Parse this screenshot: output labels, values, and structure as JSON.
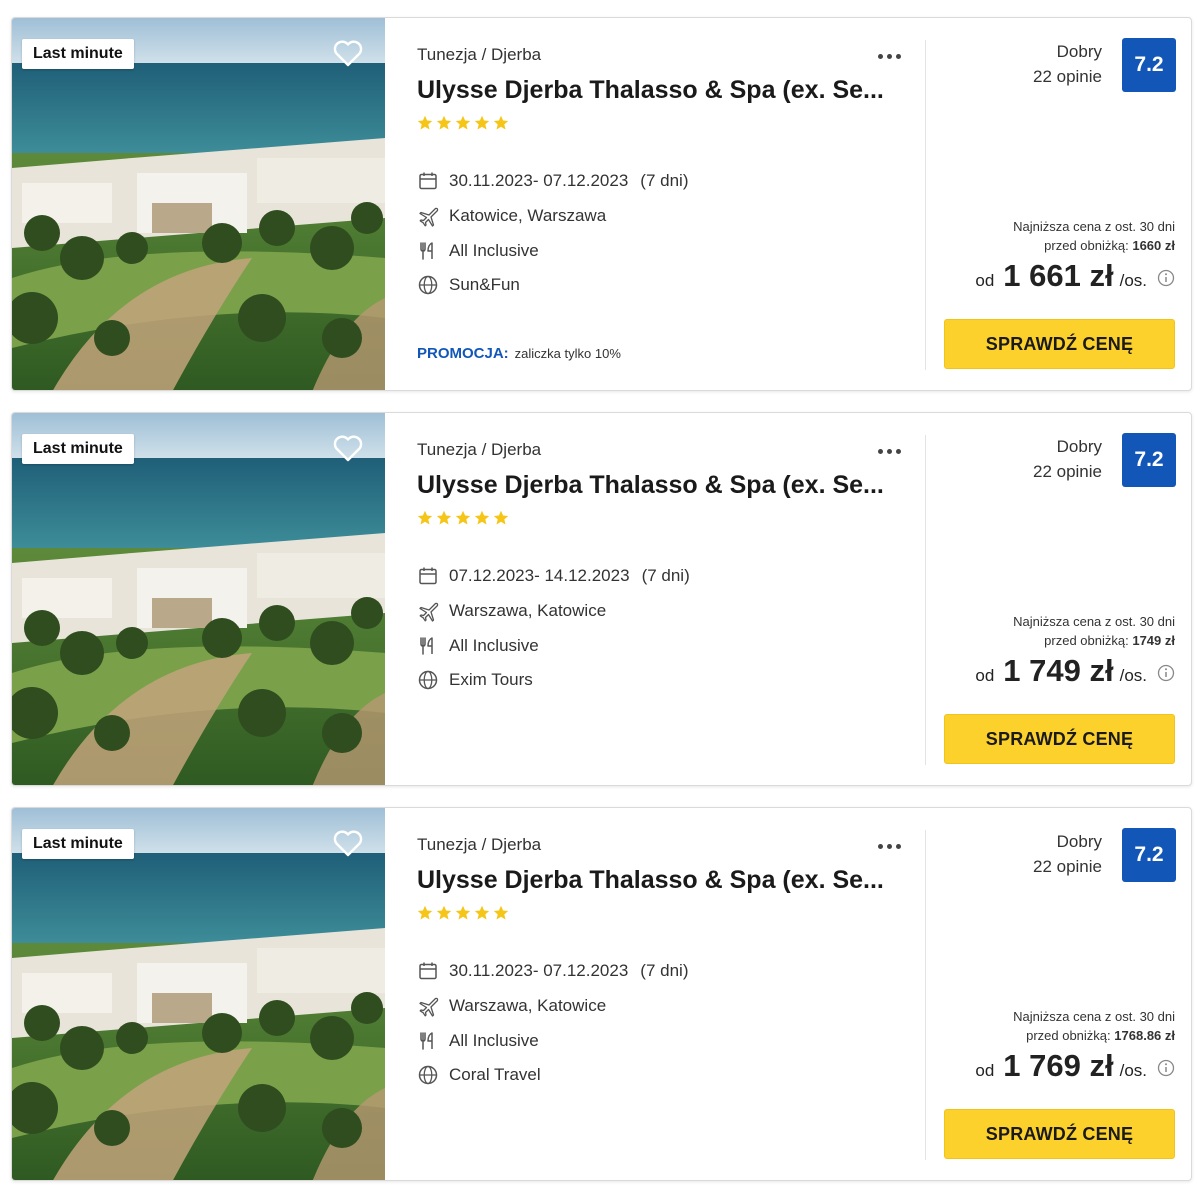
{
  "offers": [
    {
      "badge": "Last minute",
      "location": "Tunezja / Djerba",
      "title": "Ulysse Djerba Thalasso & Spa (ex. Se...",
      "stars": 5,
      "dates": "30.11.2023- 07.12.2023",
      "duration": "(7 dni)",
      "departure": "Katowice, Warszawa",
      "board": "All Inclusive",
      "operator": "Sun&Fun",
      "promo_label": "PROMOCJA:",
      "promo_text": "zaliczka tylko 10%",
      "rating_label": "Dobry",
      "rating_count": "22 opinie",
      "score": "7.2",
      "lowest_line1": "Najniższa cena z ost. 30 dni",
      "lowest_line2_prefix": "przed obniżką:",
      "lowest_value": "1660 zł",
      "price_prefix": "od",
      "price": "1 661 zł",
      "price_suffix": "/os.",
      "cta": "SPRAWDŹ CENĘ"
    },
    {
      "badge": "Last minute",
      "location": "Tunezja / Djerba",
      "title": "Ulysse Djerba Thalasso & Spa (ex. Se...",
      "stars": 5,
      "dates": "07.12.2023- 14.12.2023",
      "duration": "(7 dni)",
      "departure": "Warszawa, Katowice",
      "board": "All Inclusive",
      "operator": "Exim Tours",
      "promo_label": "",
      "promo_text": "",
      "rating_label": "Dobry",
      "rating_count": "22 opinie",
      "score": "7.2",
      "lowest_line1": "Najniższa cena z ost. 30 dni",
      "lowest_line2_prefix": "przed obniżką:",
      "lowest_value": "1749 zł",
      "price_prefix": "od",
      "price": "1 749 zł",
      "price_suffix": "/os.",
      "cta": "SPRAWDŹ CENĘ"
    },
    {
      "badge": "Last minute",
      "location": "Tunezja / Djerba",
      "title": "Ulysse Djerba Thalasso & Spa (ex. Se...",
      "stars": 5,
      "dates": "30.11.2023- 07.12.2023",
      "duration": "(7 dni)",
      "departure": "Warszawa, Katowice",
      "board": "All Inclusive",
      "operator": "Coral Travel",
      "promo_label": "",
      "promo_text": "",
      "rating_label": "Dobry",
      "rating_count": "22 opinie",
      "score": "7.2",
      "lowest_line1": "Najniższa cena z ost. 30 dni",
      "lowest_line2_prefix": "przed obniżką:",
      "lowest_value": "1768.86 zł",
      "price_prefix": "od",
      "price": "1 769 zł",
      "price_suffix": "/os.",
      "cta": "SPRAWDŹ CENĘ"
    }
  ],
  "colors": {
    "accent_blue": "#1257b8",
    "cta_yellow": "#fdd12b",
    "star_yellow": "#f5c518"
  },
  "icons": {
    "favorite": "heart-icon",
    "more": "more-dots-icon",
    "dates": "calendar-icon",
    "departure": "plane-icon",
    "board": "cutlery-icon",
    "operator": "globe-icon",
    "price_info": "info-icon",
    "category": "star-icon"
  }
}
